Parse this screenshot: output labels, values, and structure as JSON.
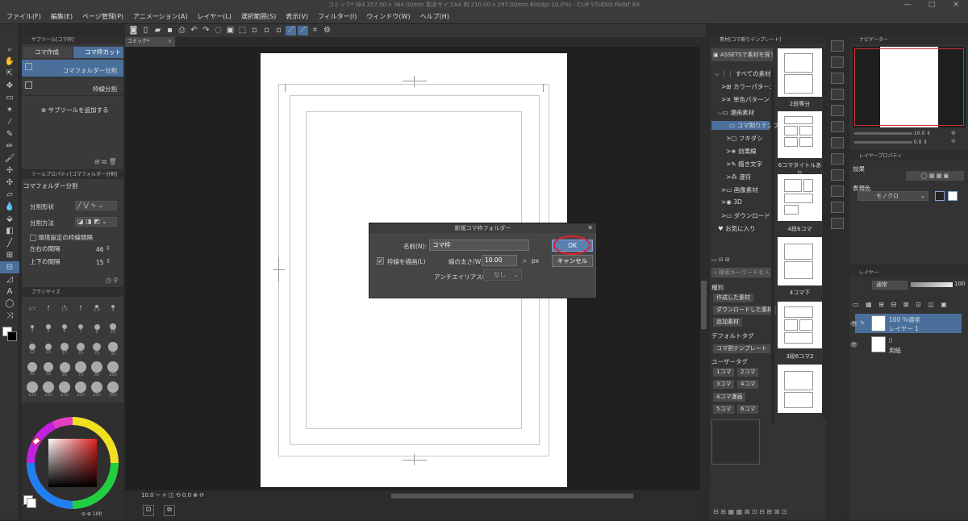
{
  "window": {
    "title": "コミック* (B4 257.00 x 364.00mm 製本サイズA4 判 210.00 x 297.00mm 600dpi 10.0%) - CLIP STUDIO PAINT EX",
    "controls": [
      "—",
      "□",
      "✕"
    ]
  },
  "menu": [
    "ファイル(F)",
    "編集(E)",
    "ページ管理(P)",
    "アニメーション(A)",
    "レイヤー(L)",
    "選択範囲(S)",
    "表示(V)",
    "フィルター(I)",
    "ウィンドウ(W)",
    "ヘルプ(H)"
  ],
  "canvas": {
    "tab_label": "コミック*"
  },
  "sub_tool": {
    "panel_title": "サブツール[コマ枠]",
    "tab_create": "コマ作成",
    "tab_cut": "コマ枠カット",
    "item_folder_split": "コマフォルダー分割",
    "item_frame_split": "枠線分割",
    "add_label": "サブツールを追加する"
  },
  "tool_property": {
    "panel_title": "ツールプロパティ[コマフォルダー分割]",
    "tool_name": "コマフォルダー分割",
    "split_shape": "分割形状",
    "split_method": "分割方法",
    "env_gap": "環境設定の枠線間隔",
    "lr_gap_label": "左右の間隔",
    "lr_gap_value": "46",
    "tb_gap_label": "上下の間隔",
    "tb_gap_value": "15"
  },
  "brush_size": {
    "panel_title": "ブラシサイズ",
    "sizes": [
      "0.7",
      "1",
      "1.5",
      "2",
      "2.5",
      "3",
      "4",
      "5",
      "6",
      "7",
      "8",
      "10",
      "12",
      "15",
      "17",
      "20",
      "25",
      "30",
      "40",
      "50",
      "60",
      "70",
      "80",
      "100",
      "120",
      "150",
      "170",
      "200",
      "250",
      "300"
    ]
  },
  "color": {
    "zoom_label": "100"
  },
  "dialog": {
    "title": "新規コマ枠フォルダー",
    "name_label": "名前(N):",
    "name_value": "コマ枠",
    "draw_border_label": "枠線を描画(L)",
    "line_width_label": "線の太さ(W):",
    "line_width_value": "10.00",
    "unit": "px",
    "antialias_label": "アンチエイリアス(A):",
    "antialias_value": "なし",
    "ok_label": "OK",
    "cancel_label": "キャンセル"
  },
  "canvas_footer": {
    "zoom": "10.0"
  },
  "material": {
    "panel_title": "素材[コマ割りテンプレート]",
    "assets_button": "ASSETSで素材を探す",
    "tree": [
      "すべての素材",
      "カラーパターン",
      "単色パターン",
      "漫画素材",
      "コマ割りテンプ",
      "フキダシ",
      "効果線",
      "描き文字",
      "漫符",
      "画像素材",
      "3D",
      "ダウンロード",
      "お気に入り"
    ],
    "search_placeholder": "検索キーワードを入",
    "kind_label": "種別",
    "kind_tags": [
      "作成した素材",
      "ダウンロードした素材",
      "追加素材"
    ],
    "default_tag_label": "デフォルトタグ",
    "default_tags": [
      "コマ割テンプレート"
    ],
    "user_tag_label": "ユーザータグ",
    "user_tags": [
      "1コマ",
      "2コマ",
      "3コマ",
      "4コマ",
      "4コマ漫画",
      "5コマ",
      "6コマ"
    ],
    "thumbs": [
      "2段等分",
      "6コマタイトルあり",
      "4段6コマ",
      "4コマ下",
      "3段6コマ2"
    ]
  },
  "navigator": {
    "panel_title": "ナビゲーター",
    "zoom_value": "10.0",
    "angle_value": "0.0"
  },
  "layer_property": {
    "panel_title": "レイヤープロパティ",
    "effect_label": "効果",
    "expression_label": "表現色",
    "expression_value": "モノクロ"
  },
  "layers": {
    "panel_title": "レイヤー",
    "blend_mode": "通常",
    "opacity": "100",
    "items": [
      {
        "name": "レイヤー 1",
        "mode": "100 %通常"
      },
      {
        "name": "用紙",
        "mode": ""
      }
    ]
  }
}
